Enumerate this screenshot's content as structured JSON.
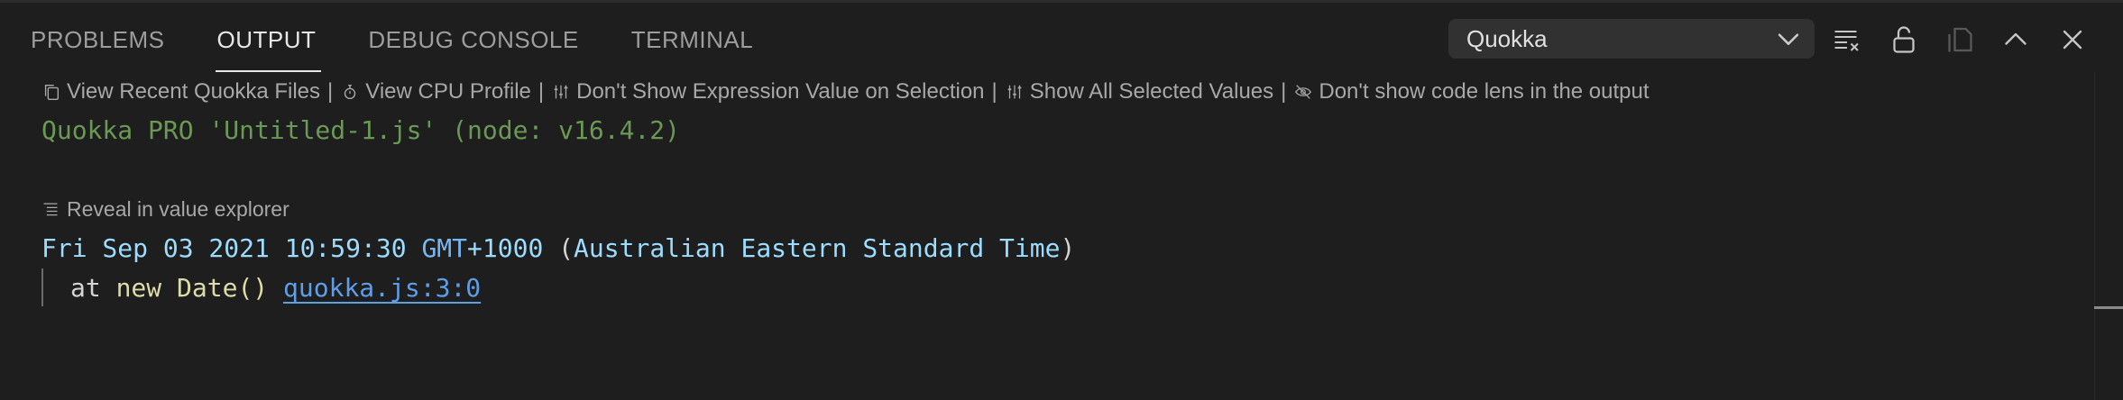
{
  "tabs": [
    {
      "label": "PROBLEMS",
      "active": false
    },
    {
      "label": "OUTPUT",
      "active": true
    },
    {
      "label": "DEBUG CONSOLE",
      "active": false
    },
    {
      "label": "TERMINAL",
      "active": false
    }
  ],
  "output_selector": {
    "value": "Quokka"
  },
  "toolbar": {
    "icons": [
      "clear-output-icon",
      "lock-scroll-icon",
      "open-in-editor-icon",
      "maximize-panel-icon",
      "close-panel-icon"
    ]
  },
  "code_lens": {
    "items": [
      {
        "label": "View Recent Quokka Files",
        "icon": "files-icon"
      },
      {
        "label": "View CPU Profile",
        "icon": "stopwatch-icon"
      },
      {
        "label": "Don't Show Expression Value on Selection",
        "icon": "settings-sliders-icon"
      },
      {
        "label": "Show All Selected Values",
        "icon": "settings-sliders-icon"
      },
      {
        "label": "Don't show code lens in the output",
        "icon": "eye-closed-icon"
      }
    ],
    "separator": "|"
  },
  "output": {
    "quokka_header": "Quokka PRO 'Untitled-1.js' (node: v16.4.2)",
    "reveal_label": "Reveal in value explorer",
    "date": {
      "part1": "Fri Sep 03 2021 10:59:30 ",
      "part2": "GMT",
      "part3": "+1000 ",
      "part4": "(",
      "part5": "Australian Eastern Standard Time",
      "part6": ")"
    },
    "stack": {
      "prefix": "at ",
      "fn": "new Date()",
      "space": " ",
      "location": "quokka.js:3:0"
    }
  },
  "colors": {
    "background": "#1e1e1e",
    "quokka_green": "#6a9955",
    "value_blue": "#9cdcfe",
    "link_blue": "#5e9ee6",
    "function_cream": "#dcdcaa"
  }
}
